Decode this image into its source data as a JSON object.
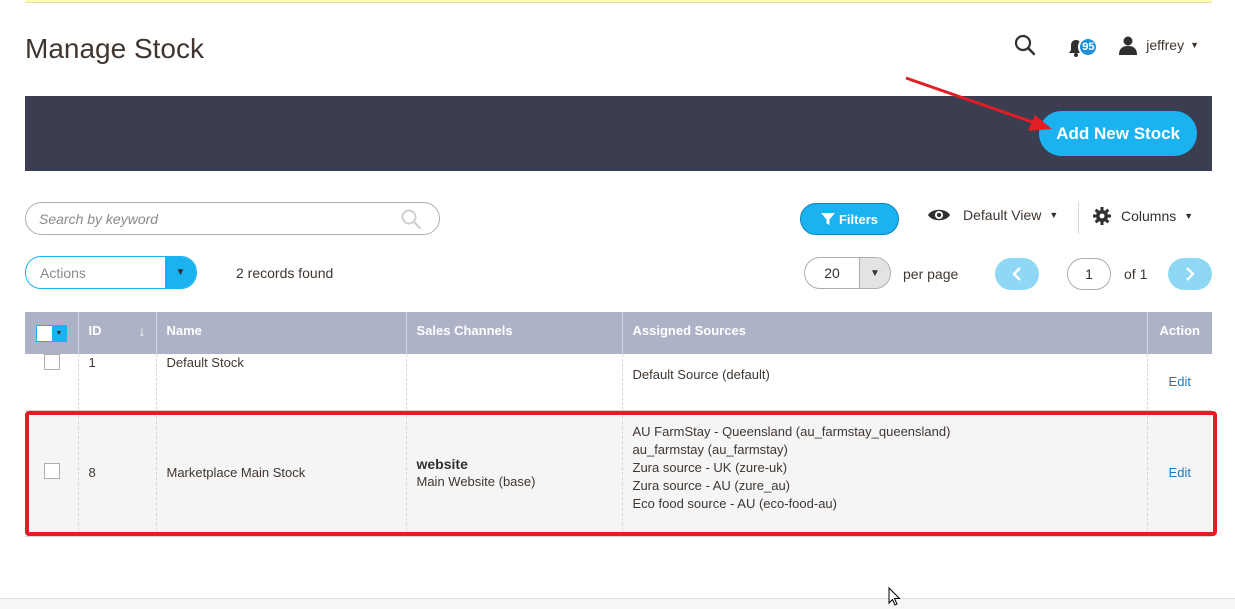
{
  "page": {
    "title": "Manage Stock"
  },
  "header": {
    "notification_count": "95",
    "username": "jeffrey"
  },
  "toolbar": {
    "add_button_label": "Add New Stock"
  },
  "search": {
    "placeholder": "Search by keyword"
  },
  "controls": {
    "filters_label": "Filters",
    "view_label": "Default View",
    "columns_label": "Columns",
    "actions_label": "Actions",
    "records_found": "2 records found",
    "per_page_value": "20",
    "per_page_label": "per page",
    "current_page": "1",
    "page_of": "of 1"
  },
  "table": {
    "columns": [
      "ID",
      "Name",
      "Sales Channels",
      "Assigned Sources",
      "Action"
    ],
    "rows": [
      {
        "id": "1",
        "name": "Default Stock",
        "channel_name": "",
        "channel_detail": "",
        "sources": [
          "Default Source (default)"
        ],
        "action": "Edit"
      },
      {
        "id": "8",
        "name": "Marketplace Main Stock",
        "channel_name": "website",
        "channel_detail": "Main Website (base)",
        "sources": [
          "AU FarmStay - Queensland (au_farmstay_queensland)",
          "au_farmstay (au_farmstay)",
          "Zura source - UK (zure-uk)",
          "Zura source - AU (zure_au)",
          "Eco food source - AU (eco-food-au)"
        ],
        "action": "Edit"
      }
    ]
  },
  "icons": {
    "search": "search-icon",
    "bell": "bell-icon",
    "user": "user-icon",
    "filter": "filter-icon",
    "eye": "eye-icon",
    "gear": "gear-icon",
    "prev": "chevron-left-icon",
    "next": "chevron-right-icon"
  },
  "colors": {
    "accent": "#1ab2f0",
    "action_bar": "#3b3e51",
    "table_header": "#adb2c6",
    "annotation": "#e31d24"
  }
}
